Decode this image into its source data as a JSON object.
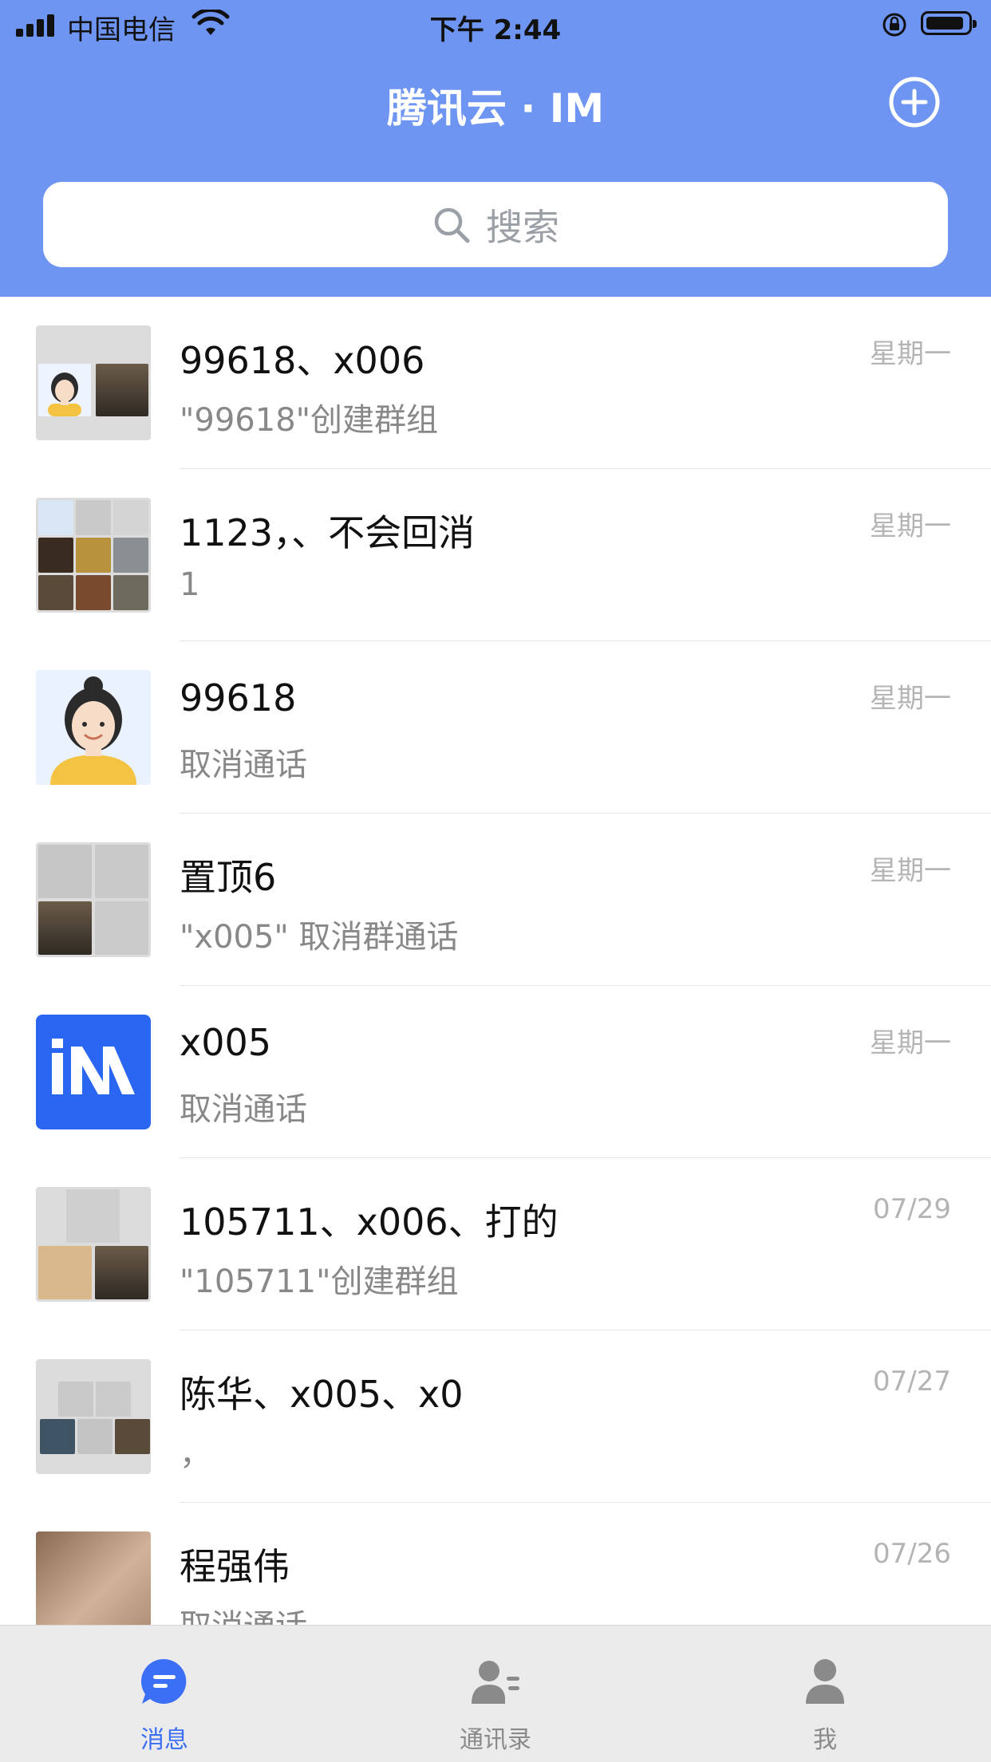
{
  "status_bar": {
    "carrier": "中国电信",
    "time": "下午 2:44"
  },
  "nav": {
    "title": "腾讯云 · IM",
    "add_icon": "plus-circle-icon"
  },
  "search": {
    "placeholder": "搜索",
    "icon": "search-icon"
  },
  "conversations": [
    {
      "name": "99618、x006",
      "last_message": "\"99618\"创建群组",
      "time": "星期一",
      "avatar": "group-avatar"
    },
    {
      "name": "1123，、不会回消",
      "last_message": "1",
      "time": "星期一",
      "avatar": "group-avatar"
    },
    {
      "name": "99618",
      "last_message": "取消通话",
      "time": "星期一",
      "avatar": "user-avatar"
    },
    {
      "name": "置顶6",
      "last_message": "\"x005\" 取消群通话",
      "time": "星期一",
      "avatar": "group-avatar"
    },
    {
      "name": "x005",
      "last_message": "取消通话",
      "time": "星期一",
      "avatar": "im-logo-avatar"
    },
    {
      "name": "105711、x006、打的",
      "last_message": "\"105711\"创建群组",
      "time": "07/29",
      "avatar": "group-avatar"
    },
    {
      "name": "陈华、x005、x0",
      "last_message": "，",
      "time": "07/27",
      "avatar": "group-avatar"
    },
    {
      "name": "程强伟",
      "last_message": "取消通话",
      "time": "07/26",
      "avatar": "user-avatar"
    }
  ],
  "tabs": [
    {
      "label": "消息",
      "icon": "message-icon",
      "active": true
    },
    {
      "label": "通讯录",
      "icon": "contacts-icon",
      "active": false
    },
    {
      "label": "我",
      "icon": "profile-icon",
      "active": false
    }
  ],
  "colors": {
    "header": "#6f95f2",
    "active_tab": "#3b6ff5",
    "inactive_tab": "#8a8a8a",
    "time_text": "#b4b4b4",
    "im_logo": "#2a66f2"
  }
}
